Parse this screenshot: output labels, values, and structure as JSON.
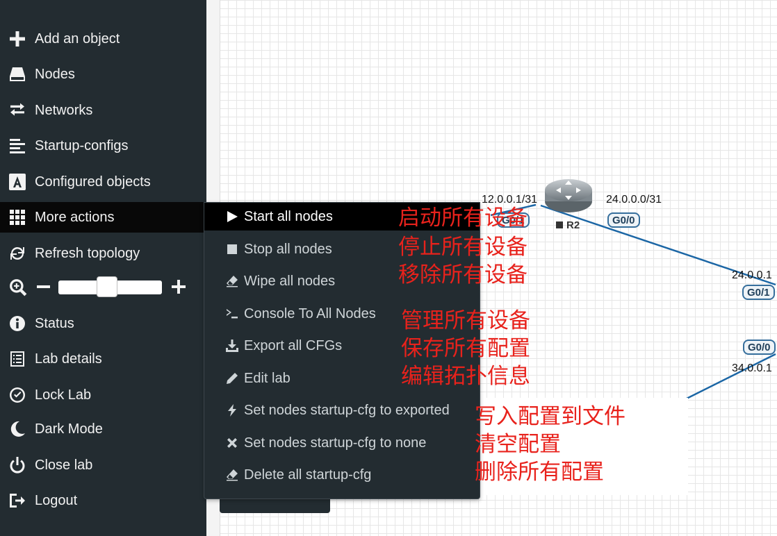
{
  "sidebar": {
    "items": [
      {
        "label": "Add an object",
        "icon": "plus-icon"
      },
      {
        "label": "Nodes",
        "icon": "hdd-icon"
      },
      {
        "label": "Networks",
        "icon": "exchange-icon"
      },
      {
        "label": "Startup-configs",
        "icon": "align-left-icon"
      },
      {
        "label": "Configured objects",
        "icon": "font-a-icon"
      },
      {
        "label": "More actions",
        "icon": "grid-icon"
      },
      {
        "label": "Refresh topology",
        "icon": "refresh-icon"
      },
      {
        "label": "Status",
        "icon": "info-icon"
      },
      {
        "label": "Lab details",
        "icon": "list-icon"
      },
      {
        "label": "Lock Lab",
        "icon": "check-circle-icon"
      },
      {
        "label": "Dark Mode",
        "icon": "moon-icon"
      },
      {
        "label": "Close lab",
        "icon": "power-icon"
      },
      {
        "label": "Logout",
        "icon": "logout-icon"
      }
    ],
    "zoom_level": 0.46
  },
  "dropdown": {
    "items": [
      {
        "label": "Start all nodes",
        "icon": "play-icon"
      },
      {
        "label": "Stop all nodes",
        "icon": "stop-icon"
      },
      {
        "label": "Wipe all nodes",
        "icon": "eraser-icon"
      },
      {
        "label": "Console To All Nodes",
        "icon": "terminal-icon"
      },
      {
        "label": "Export all CFGs",
        "icon": "download-icon"
      },
      {
        "label": "Edit lab",
        "icon": "pencil-icon"
      },
      {
        "label": "Set nodes startup-cfg to exported",
        "icon": "bolt-icon"
      },
      {
        "label": "Set nodes startup-cfg to none",
        "icon": "x-icon"
      },
      {
        "label": "Delete all startup-cfg",
        "icon": "eraser-icon"
      }
    ]
  },
  "annotations": [
    "启动所有设备",
    "停止所有设备",
    "移除所有设备",
    "管理所有设备",
    "保存所有配置",
    "编辑拓扑信息",
    "写入配置到文件",
    "清空配置",
    "删除所有配置"
  ],
  "topology": {
    "node_name": "R2",
    "labels": [
      "12.0.0.1/31",
      "24.0.0.0/31",
      "24.0.0.1",
      "34.0.0.1"
    ],
    "ports": [
      "G0/1",
      "G0/0",
      "G0/1",
      "G0/0"
    ]
  },
  "colors": {
    "sidebar_bg": "#232c31",
    "active_bg": "#000000",
    "annotation": "#e8221c",
    "link": "#1b66a5"
  }
}
